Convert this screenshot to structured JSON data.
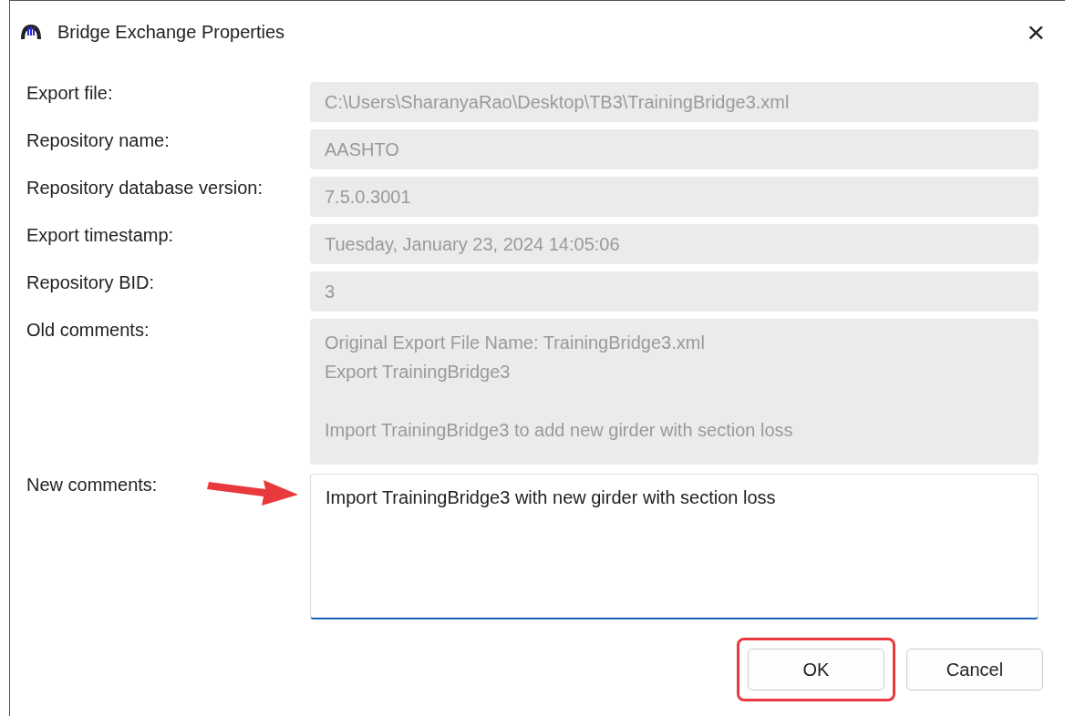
{
  "window": {
    "title": "Bridge Exchange Properties",
    "close": "×"
  },
  "fields": [
    {
      "label": "Export file:",
      "value": "C:\\Users\\SharanyaRao\\Desktop\\TB3\\TrainingBridge3.xml",
      "disabled": true
    },
    {
      "label": "Repository name:",
      "value": "AASHTO",
      "disabled": true
    },
    {
      "label": "Repository database version:",
      "value": "7.5.0.3001",
      "disabled": true
    },
    {
      "label": "Export timestamp:",
      "value": "Tuesday, January 23, 2024 14:05:06",
      "disabled": true
    },
    {
      "label": "Repository BID:",
      "value": "3",
      "disabled": true
    }
  ],
  "old_comments": {
    "label": "Old comments:",
    "text": "Original Export File Name: TrainingBridge3.xml\nExport TrainingBridge3\n\nImport TrainingBridge3 to add new girder with section loss",
    "disabled": true
  },
  "new_comments": {
    "label": "New comments:",
    "value": "Import TrainingBridge3 with new girder with section loss",
    "focused": true,
    "pointed_at": true
  },
  "buttons": [
    {
      "label": "OK",
      "highlighted": true
    },
    {
      "label": "Cancel",
      "highlighted": false
    }
  ]
}
